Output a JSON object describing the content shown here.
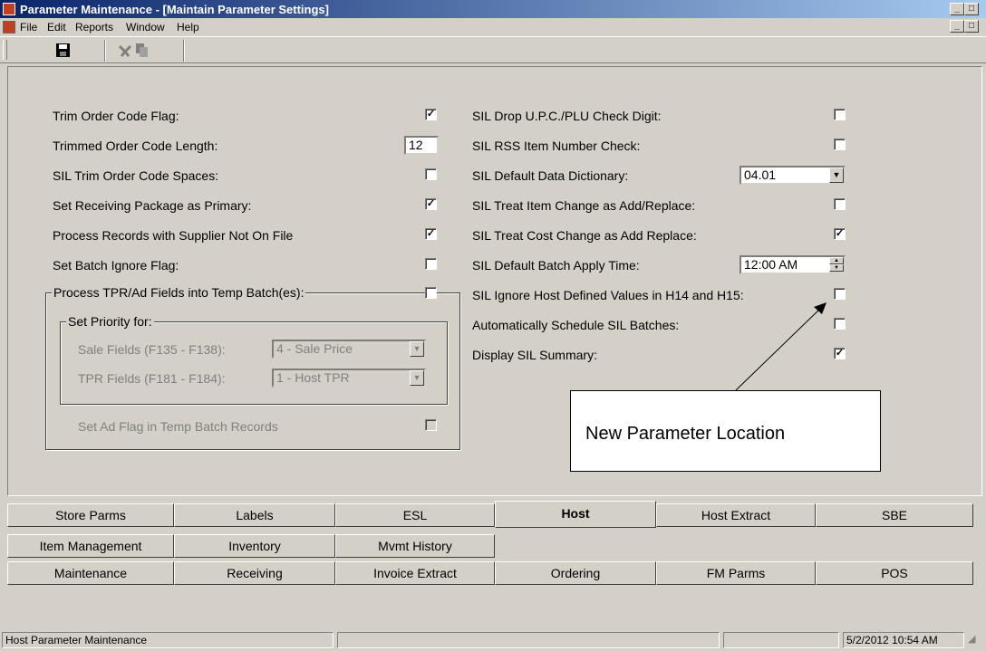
{
  "window": {
    "title": "Parameter Maintenance - [Maintain Parameter Settings]",
    "min": "_",
    "max": "□",
    "close": "×",
    "restore": "🗗"
  },
  "menu": [
    "File",
    "Edit",
    "Reports",
    "Window",
    "Help"
  ],
  "left": {
    "trim_order_code_flag": {
      "label": "Trim Order Code Flag:",
      "checked": true
    },
    "trimmed_order_code_length": {
      "label": "Trimmed Order Code Length:",
      "value": "12"
    },
    "sil_trim_spaces": {
      "label": "SIL Trim Order Code Spaces:",
      "checked": false
    },
    "set_receiving_primary": {
      "label": "Set Receiving Package as Primary:",
      "checked": true
    },
    "process_supplier_not_on_file": {
      "label": "Process Records with Supplier Not On File",
      "checked": true
    },
    "set_batch_ignore": {
      "label": "Set Batch Ignore Flag:",
      "checked": false
    },
    "process_tpr": {
      "label": "Process TPR/Ad Fields into Temp Batch(es):",
      "checked": false
    },
    "set_priority": {
      "label": "Set Priority for:"
    },
    "sale_fields": {
      "label": "Sale Fields (F135 - F138):",
      "value": "4 - Sale Price"
    },
    "tpr_fields": {
      "label": "TPR Fields (F181 - F184):",
      "value": "1 - Host TPR"
    },
    "set_ad_flag": {
      "label": "Set Ad Flag in Temp Batch Records",
      "checked": false
    }
  },
  "right": {
    "drop_upc": {
      "label": "SIL Drop U.P.C./PLU Check Digit:",
      "checked": false
    },
    "rss_check": {
      "label": "SIL RSS Item Number Check:",
      "checked": false
    },
    "data_dictionary": {
      "label": "SIL Default Data Dictionary:",
      "value": "04.01"
    },
    "item_change": {
      "label": "SIL Treat Item Change as Add/Replace:",
      "checked": false
    },
    "cost_change": {
      "label": "SIL Treat Cost Change as Add Replace:",
      "checked": true
    },
    "apply_time": {
      "label": "SIL Default Batch Apply Time:",
      "value": "12:00 AM"
    },
    "ignore_host": {
      "label": "SIL Ignore Host Defined Values in H14 and H15:",
      "checked": false
    },
    "auto_schedule": {
      "label": "Automatically Schedule SIL Batches:",
      "checked": false
    },
    "display_summary": {
      "label": "Display SIL Summary:",
      "checked": true
    }
  },
  "callout": "New Parameter Location",
  "tabs": {
    "row1": [
      "Store Parms",
      "Labels",
      "ESL",
      "Host",
      "Host Extract",
      "SBE"
    ],
    "row2": [
      "Item Management",
      "Inventory",
      "Mvmt History"
    ],
    "row3": [
      "Maintenance",
      "Receiving",
      "Invoice Extract",
      "Ordering",
      "FM Parms",
      "POS"
    ],
    "active": "Host"
  },
  "status": {
    "text": "Host Parameter Maintenance",
    "datetime": "5/2/2012 10:54 AM"
  },
  "glyphs": {
    "check": "✓",
    "down": "▼",
    "up": "▲"
  }
}
